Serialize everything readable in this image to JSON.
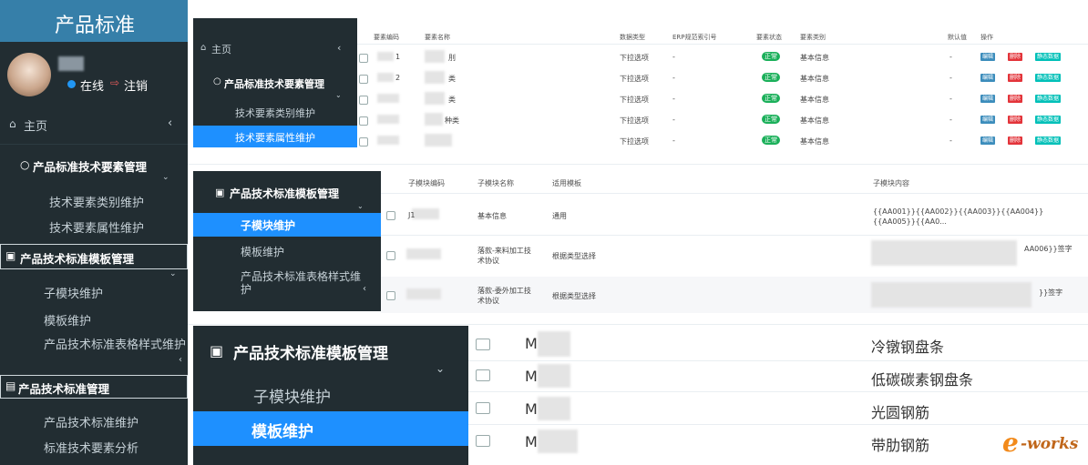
{
  "left_sidebar": {
    "brand": "产品标准",
    "status_online": "在线",
    "logout": "注销",
    "home": "主页",
    "home_caret": "‹",
    "section1": "产品标准技术要素管理",
    "item_category": "技术要素类别维护",
    "item_attribute": "技术要素属性维护",
    "section2": "产品技术标准模板管理",
    "item_submodule": "子模块维护",
    "item_template": "模板维护",
    "item_table_style": "产品技术标准表格样式维护",
    "section3": "产品技术标准管理",
    "item_std_maint": "产品技术标准维护",
    "item_std_analysis": "标准技术要素分析"
  },
  "panel1": {
    "home": "主页",
    "caret": "‹",
    "section": "产品标准技术要素管理",
    "item1": "技术要素类别维护",
    "item2": "技术要素属性维护",
    "headers": [
      "要素编码",
      "要素名称",
      "数据类型",
      "ERP规范索引号",
      "要素状态",
      "要素类别",
      "默认值",
      "操作"
    ],
    "rows": [
      {
        "code": "1",
        "name": "刖",
        "type": "下拉选项",
        "erp": "-",
        "status": "正常",
        "category": "基本信息",
        "default": "-"
      },
      {
        "code": "2",
        "name": "类",
        "type": "下拉选项",
        "erp": "-",
        "status": "正常",
        "category": "基本信息",
        "default": "-"
      },
      {
        "code": "",
        "name": "类",
        "type": "下拉选项",
        "erp": "-",
        "status": "正常",
        "category": "基本信息",
        "default": "-"
      },
      {
        "code": "",
        "name": "种类",
        "type": "下拉选项",
        "erp": "-",
        "status": "正常",
        "category": "基本信息",
        "default": "-"
      },
      {
        "code": "",
        "name": "",
        "type": "下拉选项",
        "erp": "-",
        "status": "正常",
        "category": "基本信息",
        "default": "-"
      }
    ],
    "btn_edit": "编辑",
    "btn_delete": "删除",
    "btn_static": "静态数据"
  },
  "panel2": {
    "section": "产品技术标准模板管理",
    "item1": "子模块维护",
    "item2": "模板维护",
    "item3": "产品技术标准表格样式维护",
    "caret": "‹",
    "headers": [
      "子模块编码",
      "子模块名称",
      "适用模板",
      "子模块内容"
    ],
    "rows": [
      {
        "code": "J1",
        "name": "基本信息",
        "template": "通用",
        "content": "{{AA001}}{{AA002}}{{AA003}}{{AA004}}{{AA005}}{{AA0..."
      },
      {
        "code": "",
        "name": "落款-来料加工技术协议",
        "template": "根据类型选择",
        "content": "AA006}}签字"
      },
      {
        "code": "",
        "name": "落款-委外加工技术协议",
        "template": "根据类型选择",
        "content": "}}签字"
      }
    ]
  },
  "panel3": {
    "section": "产品技术标准模板管理",
    "item1": "子模块维护",
    "item2": "模板维护",
    "codes": [
      "M",
      "M",
      "M",
      "M"
    ],
    "names": [
      "冷镦钢盘条",
      "低碳碳素钢盘条",
      "光圆钢筋",
      "带肋钢筋"
    ]
  },
  "watermark": {
    "prefix": "e",
    "text": "-works"
  },
  "colors": {
    "sidebar_bg": "#222d32",
    "brand_bg": "#367fa9",
    "active_blue": "#1e90ff",
    "status_green": "#1bb05a"
  }
}
